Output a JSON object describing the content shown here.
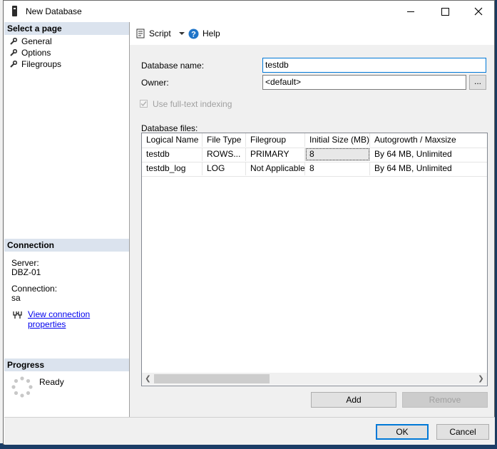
{
  "window": {
    "title": "New Database",
    "controls": {
      "minimize": "minimize-icon",
      "maximize": "maximize-icon",
      "close": "✕"
    }
  },
  "left_pane": {
    "select_page_header": "Select a page",
    "pages": [
      {
        "label": "General",
        "icon": "wrench-icon"
      },
      {
        "label": "Options",
        "icon": "wrench-icon"
      },
      {
        "label": "Filegroups",
        "icon": "wrench-icon"
      }
    ],
    "connection": {
      "header": "Connection",
      "server_label": "Server:",
      "server_value": "DBZ-01",
      "connection_label": "Connection:",
      "connection_value": "sa",
      "view_properties_link": "View connection properties"
    },
    "progress": {
      "header": "Progress",
      "status": "Ready"
    }
  },
  "toolbar": {
    "script_label": "Script",
    "help_label": "Help"
  },
  "general": {
    "database_name_label": "Database name:",
    "database_name_value": "testdb",
    "owner_label": "Owner:",
    "owner_value": "<default>",
    "owner_browse": "...",
    "fulltext_label": "Use full-text indexing",
    "fulltext_checked": true,
    "files_label": "Database files:"
  },
  "files_table": {
    "columns": [
      "Logical Name",
      "File Type",
      "Filegroup",
      "Initial Size (MB)",
      "Autogrowth / Maxsize"
    ],
    "rows": [
      [
        "testdb",
        "ROWS...",
        "PRIMARY",
        "8",
        "By 64 MB, Unlimited"
      ],
      [
        "testdb_log",
        "LOG",
        "Not Applicable",
        "8",
        "By 64 MB, Unlimited"
      ]
    ]
  },
  "buttons": {
    "add": "Add",
    "remove": "Remove",
    "ok": "OK",
    "cancel": "Cancel"
  },
  "colors": {
    "section_header": "#dbe3ee",
    "link": "#0000ee",
    "primary_border": "#0078d7",
    "help_icon": "#1e74c8"
  }
}
